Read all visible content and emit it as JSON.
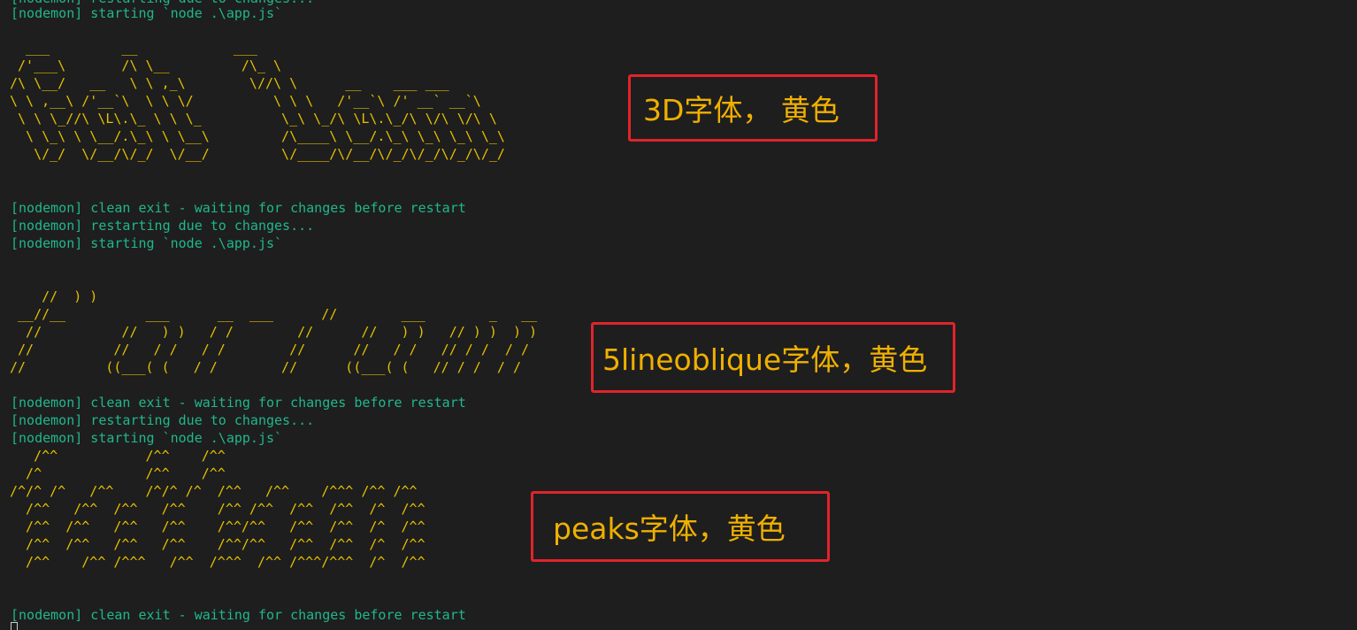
{
  "log": {
    "top_partial": "[nodemon] restarting due to changes...",
    "block1": [
      "[nodemon] starting `node .\\app.js`"
    ],
    "block2": [
      "[nodemon] clean exit - waiting for changes before restart",
      "[nodemon] restarting due to changes...",
      "[nodemon] starting `node .\\app.js`"
    ],
    "block3": [
      "[nodemon] clean exit - waiting for changes before restart",
      "[nodemon] restarting due to changes...",
      "[nodemon] starting `node .\\app.js`"
    ],
    "block4": [
      "[nodemon] clean exit - waiting for changes before restart"
    ]
  },
  "art": {
    "three_d": "  ___         __            ___\n /'___\\       /\\ \\__         /\\_ \\\n/\\ \\__/   __   \\ \\ ,_\\        \\//\\ \\      __    ___ ___\n\\ \\ ,__\\ /'__`\\  \\ \\ \\/          \\ \\ \\   /'__`\\ /' __` __`\\\n \\ \\ \\_//\\ \\L\\.\\_ \\ \\ \\_          \\_\\ \\_/\\ \\L\\.\\_/\\ \\/\\ \\/\\ \\\n  \\ \\_\\ \\ \\__/.\\_\\ \\ \\__\\         /\\____\\ \\__/.\\_\\ \\_\\ \\_\\ \\_\\\n   \\/_/  \\/__/\\/_/  \\/__/         \\/____/\\/__/\\/_/\\/_/\\/_/\\/_/",
    "five_line": "    //  ) )\n __//__          ___      __  ___      //        ___        _   __\n  //          //   ) )   / /        //      //   ) )   // ) )  ) )\n //          //   / /   / /        //      //   / /   // / /  / /\n//          ((___( (   / /        //      ((___( (   // / /  / /",
    "peaks": "   /^^           /^^    /^^\n  /^             /^^    /^^\n/^/^ /^   /^^    /^/^ /^  /^^   /^^    /^^^ /^^ /^^\n  /^^   /^^  /^^   /^^    /^^ /^^  /^^  /^^  /^  /^^\n  /^^  /^^   /^^   /^^    /^^/^^   /^^  /^^  /^  /^^\n  /^^  /^^   /^^   /^^    /^^/^^   /^^  /^^  /^  /^^\n  /^^    /^^ /^^^   /^^  /^^^  /^^ /^^^/^^^  /^  /^^"
  },
  "annotations": {
    "a1": "3D字体， 黄色",
    "a2": "5lineoblique字体，黄色",
    "a3": "peaks字体，黄色"
  },
  "colors": {
    "log_text": "#1fb88c",
    "art_text": "#e5c000",
    "annotation_text": "#f0b000",
    "annotation_border": "#e0242b",
    "background": "#1e1e1e"
  }
}
